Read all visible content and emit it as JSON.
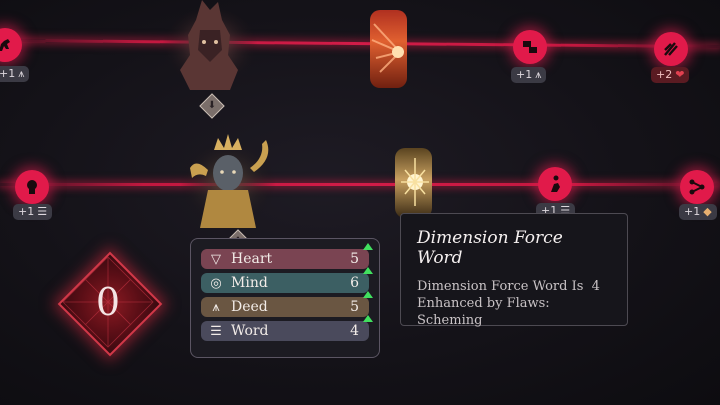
{
  "nodes": {
    "left_top_badge": "+1",
    "right1_top_badge": "+1",
    "right2_top_badge": "+2",
    "left_mid_badge": "+1",
    "right1_mid_badge": "+1",
    "right2_mid_badge": "+1"
  },
  "counter": {
    "value": "0"
  },
  "stats": [
    {
      "label": "Heart",
      "value": "5",
      "color": "#7a4452"
    },
    {
      "label": "Mind",
      "value": "6",
      "color": "#3c5f63"
    },
    {
      "label": "Deed",
      "value": "5",
      "color": "#6a5642"
    },
    {
      "label": "Word",
      "value": "4",
      "color": "#4a4a5c"
    }
  ],
  "tooltip": {
    "title": "Dimension Force Word",
    "line1": "Dimension Force Word Is  4",
    "line2": "Enhanced by Flaws:",
    "line3": "Scheming"
  },
  "colors": {
    "thread": "#c2183f",
    "node": "#e11a4a",
    "upgrade": "#41e05f"
  }
}
